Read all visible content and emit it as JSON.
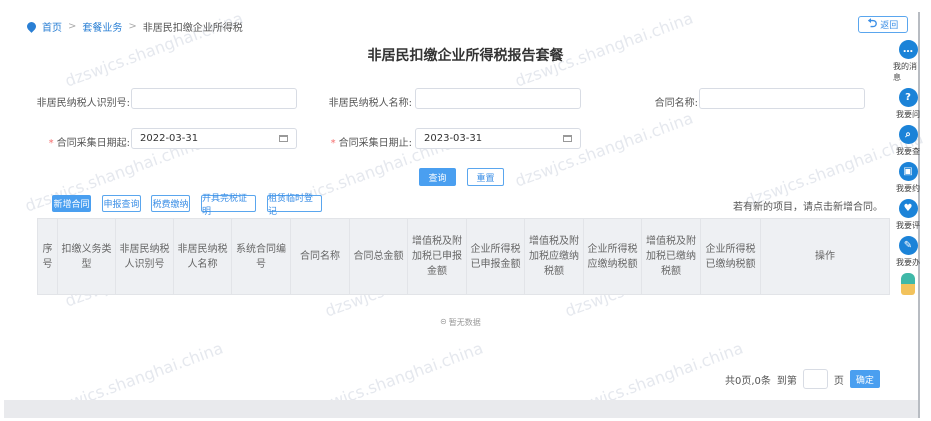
{
  "breadcrumb": {
    "home": "首页",
    "level1": "套餐业务",
    "current": "非居民扣缴企业所得税"
  },
  "page_title": "非居民扣缴企业所得税报告套餐",
  "return_label": "返回",
  "form": {
    "taxpayer_id_label": "非居民纳税人识别号:",
    "taxpayer_id_value": "",
    "taxpayer_name_label": "非居民纳税人名称:",
    "taxpayer_name_value": "",
    "contract_name_label": "合同名称:",
    "contract_name_value": "",
    "date_from_label": "合同采集日期起:",
    "date_from_value": "2022-03-31",
    "date_to_label": "合同采集日期止:",
    "date_to_value": "2023-03-31",
    "required_mark": "*"
  },
  "actions": {
    "query": "查询",
    "reset": "重置"
  },
  "toolbar": [
    "新增合同",
    "申报查询",
    "税费缴纳",
    "开具完税证明",
    "租赁临时登记"
  ],
  "hint": "若有新的项目，请点击新增合同。",
  "table": {
    "columns": [
      "序号",
      "扣缴义务类型",
      "非居民纳税人识别号",
      "非居民纳税人名称",
      "系统合同编号",
      "合同名称",
      "合同总金额",
      "增值税及附加税已申报金额",
      "企业所得税已申报金额",
      "增值税及附加税应缴纳税额",
      "企业所得税应缴纳税额",
      "增值税及附加税已缴纳税额",
      "企业所得税已缴纳税额",
      "操作"
    ],
    "empty_text": "暂无数据"
  },
  "pagination": {
    "summary": "共0页,0条",
    "goto_label": "到第",
    "page_value": "",
    "page_suffix": "页",
    "confirm": "确定"
  },
  "side_menu": [
    {
      "label": "我的消息",
      "icon": "message-icon",
      "glyph": "…"
    },
    {
      "label": "我要问",
      "icon": "question-icon",
      "glyph": "?"
    },
    {
      "label": "我要查",
      "icon": "search-icon",
      "glyph": "⌕"
    },
    {
      "label": "我要约",
      "icon": "calendar-icon",
      "glyph": "▣"
    },
    {
      "label": "我要评",
      "icon": "shield-icon",
      "glyph": "♥"
    },
    {
      "label": "我要办",
      "icon": "edit-icon",
      "glyph": "✎"
    }
  ],
  "watermark": "dzswjcs.shanghai.china"
}
